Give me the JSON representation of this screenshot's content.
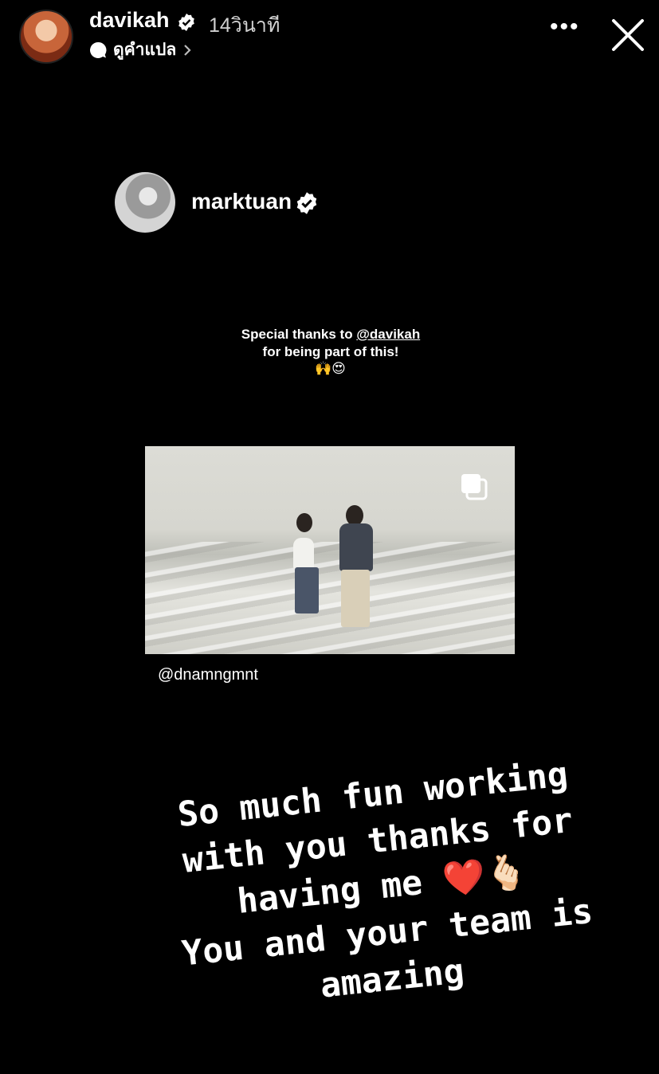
{
  "header": {
    "username": "davikah",
    "time": "14วินาที",
    "translate_label": "ดูคำแปล"
  },
  "repost": {
    "username": "marktuan",
    "message_line1": "Special thanks to ",
    "mention": "@davikah",
    "message_line2": "for being part of this!",
    "emojis": "🙌😍",
    "credit": "@dnamngmnt"
  },
  "caption": {
    "text": "So much fun working\nwith you thanks for\nhaving me ❤️🫰🏻\nYou and your team is\namazing"
  }
}
